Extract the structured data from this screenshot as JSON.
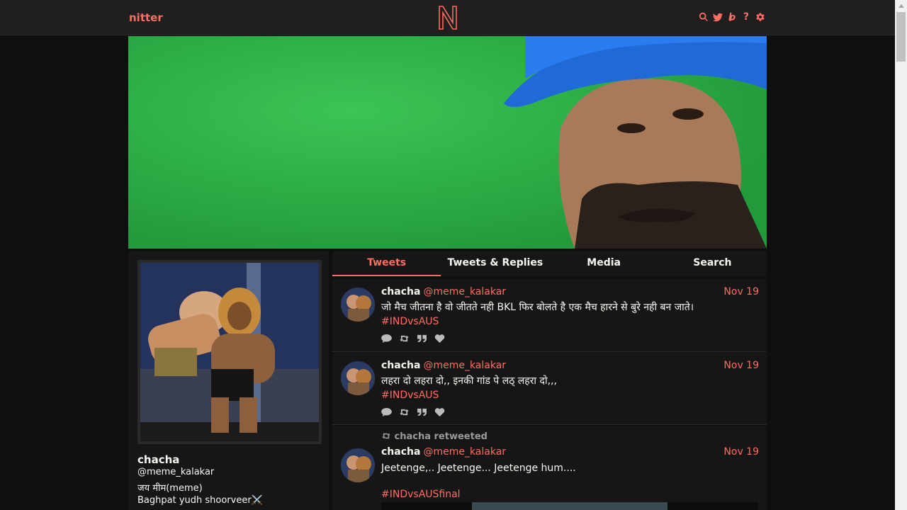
{
  "nav": {
    "brand": "nitter",
    "logo_letter": "N",
    "icons": [
      "search-icon",
      "twitter-icon",
      "liberapay-icon",
      "help-icon",
      "gear-icon"
    ],
    "help_glyph": "?",
    "accent": "#ff6c60"
  },
  "profile": {
    "fullname": "chacha",
    "username": "@meme_kalakar",
    "bio_line1": "जय मीम(meme)",
    "bio_line2": "Baghpat yudh shoorveer⚔️"
  },
  "tabs": [
    {
      "label": "Tweets",
      "active": true
    },
    {
      "label": "Tweets & Replies",
      "active": false
    },
    {
      "label": "Media",
      "active": false
    },
    {
      "label": "Search",
      "active": false
    }
  ],
  "tweets": [
    {
      "fullname": "chacha",
      "username": "@meme_kalakar",
      "date": "Nov 19",
      "text": "जो मैच जीतना है वो जीतते नही BKL फिर बोलते है एक मैच हारने से बुरे नही बन जाते।",
      "hashtag": "#INDvsAUS"
    },
    {
      "fullname": "chacha",
      "username": "@meme_kalakar",
      "date": "Nov 19",
      "text": "लहरा दो लहरा दो,, इनकी गांड पे लठ् लहरा दो,,,",
      "hashtag": "#INDvsAUS"
    },
    {
      "retweet_label": "chacha retweeted",
      "fullname": "chacha",
      "username": "@meme_kalakar",
      "date": "Nov 19",
      "text": "Jeetenge,.. Jeetenge... Jeetenge hum....",
      "hashtag": "#INDvsAUSfinal"
    }
  ]
}
